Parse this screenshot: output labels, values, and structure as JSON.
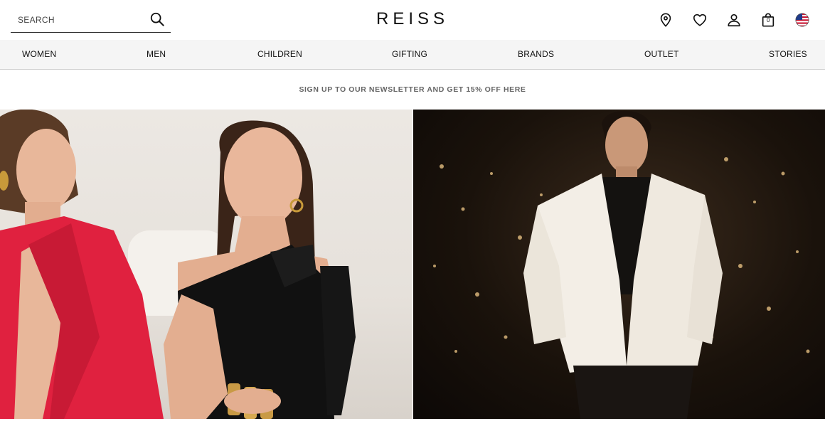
{
  "header": {
    "search_placeholder": "SEARCH",
    "logo": "REISS",
    "bag_count": "0"
  },
  "nav": {
    "items": [
      "WOMEN",
      "MEN",
      "CHILDREN",
      "GIFTING",
      "BRANDS",
      "OUTLET",
      "STORIES"
    ]
  },
  "promo": {
    "text": "SIGN UP TO OUR NEWSLETTER AND GET 15% OFF HERE"
  },
  "icons": [
    "search-icon",
    "location-pin-icon",
    "heart-icon",
    "account-icon",
    "bag-icon",
    "us-flag-icon"
  ],
  "colors": {
    "nav_bg": "#f5f5f5",
    "promo_text": "#666666",
    "red_blazer": "#e0213f"
  }
}
